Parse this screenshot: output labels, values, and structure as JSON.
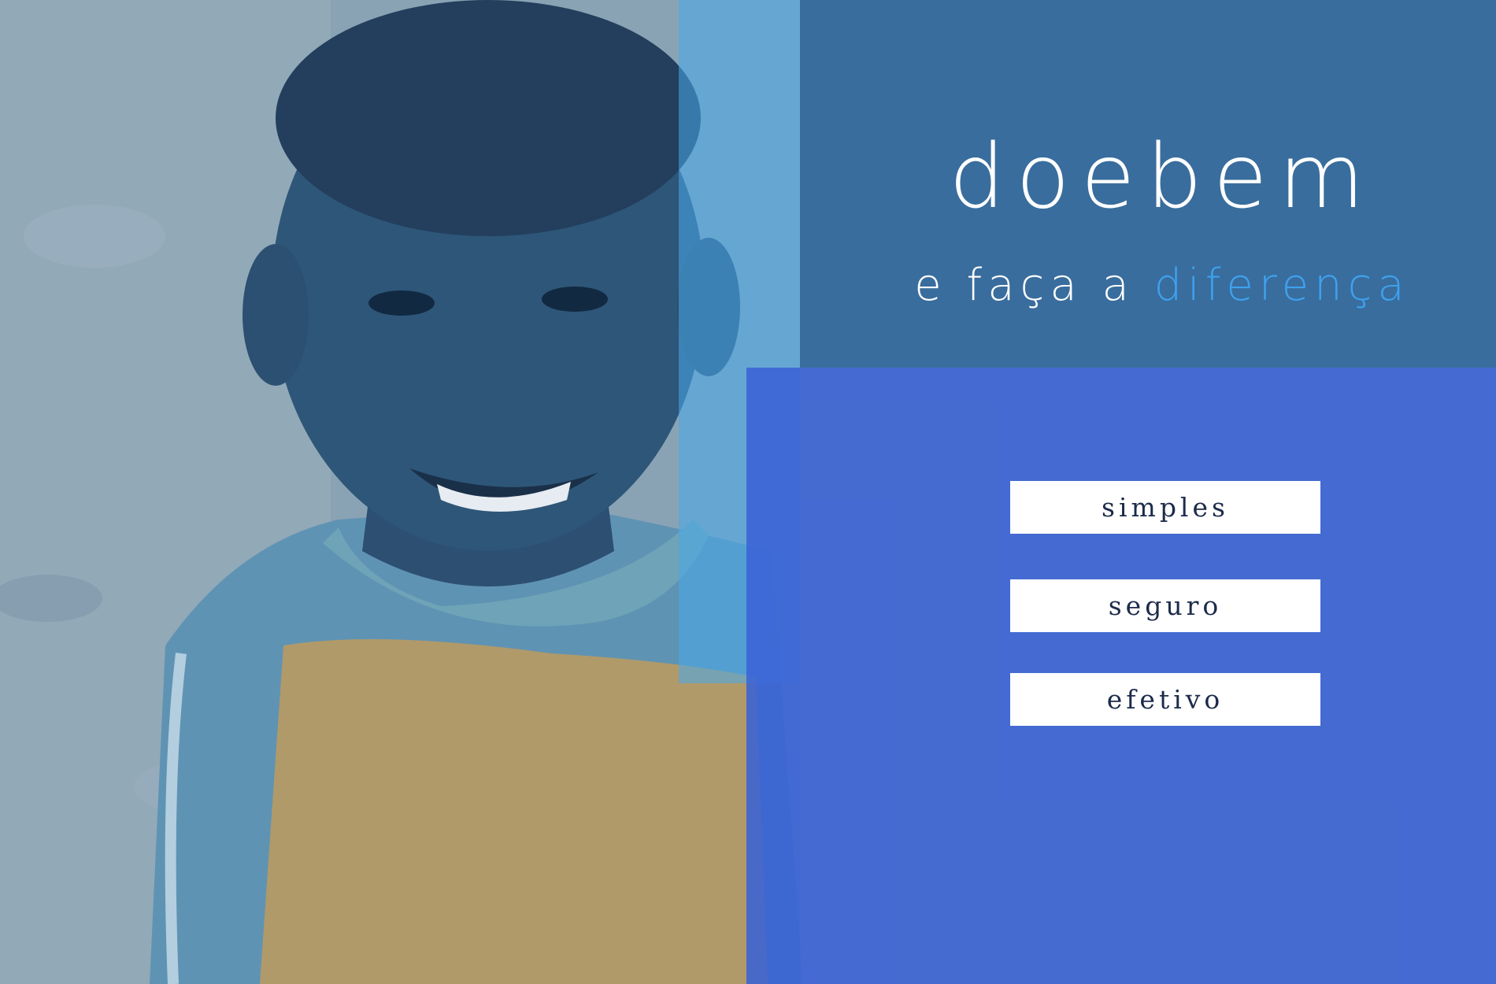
{
  "brand": {
    "name": "doebem",
    "tagline_prefix": "e faça a",
    "tagline_highlight": "diferença"
  },
  "features": [
    "simples",
    "seguro",
    "efetivo"
  ],
  "colors": {
    "top_panel": "#225e96",
    "bottom_panel": "#3a62d6",
    "accent_strip": "#48aaeb",
    "highlight_text": "#3ea1ee",
    "pill_text": "#1c2b4a"
  },
  "image": {
    "subject": "smiling child photo background"
  }
}
